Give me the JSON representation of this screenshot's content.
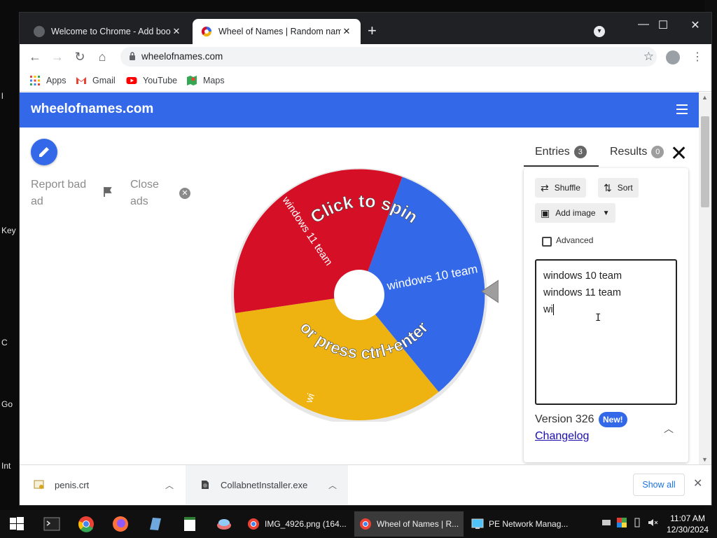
{
  "desktop": {
    "left_labels": [
      "l",
      "Key",
      "C",
      "Go",
      "Int"
    ]
  },
  "browser": {
    "tabs": [
      {
        "title": "Welcome to Chrome - Add book",
        "active": false
      },
      {
        "title": "Wheel of Names | Random name",
        "active": true
      }
    ],
    "url": "wheelofnames.com",
    "bookmarks": [
      {
        "label": "Apps",
        "icon": "apps-grid-icon"
      },
      {
        "label": "Gmail",
        "icon": "gmail-icon"
      },
      {
        "label": "YouTube",
        "icon": "youtube-icon"
      },
      {
        "label": "Maps",
        "icon": "maps-icon"
      }
    ]
  },
  "site": {
    "title": "wheelofnames.com",
    "report_ad": "Report bad ad",
    "close_ads": "Close ads",
    "wheel": {
      "cta_top": "Click to spin",
      "cta_bottom": "or press ctrl+enter",
      "segments": [
        {
          "label": "windows 10 team",
          "color": "#3369e8"
        },
        {
          "label": "windows 11 team",
          "color": "#d50f25"
        },
        {
          "label": "wi",
          "color": "#eeb211"
        }
      ]
    }
  },
  "entries_panel": {
    "tab_entries": "Entries",
    "entries_count": "3",
    "tab_results": "Results",
    "results_count": "0",
    "shuffle": "Shuffle",
    "sort": "Sort",
    "add_image": "Add image",
    "advanced": "Advanced",
    "entries_text": [
      "windows 10 team",
      "windows 11 team",
      "wi"
    ],
    "version": "Version 326",
    "new_badge": "New!",
    "changelog": "Changelog"
  },
  "downloads": {
    "items": [
      {
        "name": "penis.crt"
      },
      {
        "name": "CollabnetInstaller.exe"
      }
    ],
    "show_all": "Show all"
  },
  "taskbar": {
    "apps": [
      {
        "label": "IMG_4926.png (164...",
        "active": false
      },
      {
        "label": "Wheel of Names | R...",
        "active": true
      },
      {
        "label": "PE Network Manag...",
        "active": false
      }
    ],
    "time": "11:07 AM",
    "date": "12/30/2024"
  }
}
